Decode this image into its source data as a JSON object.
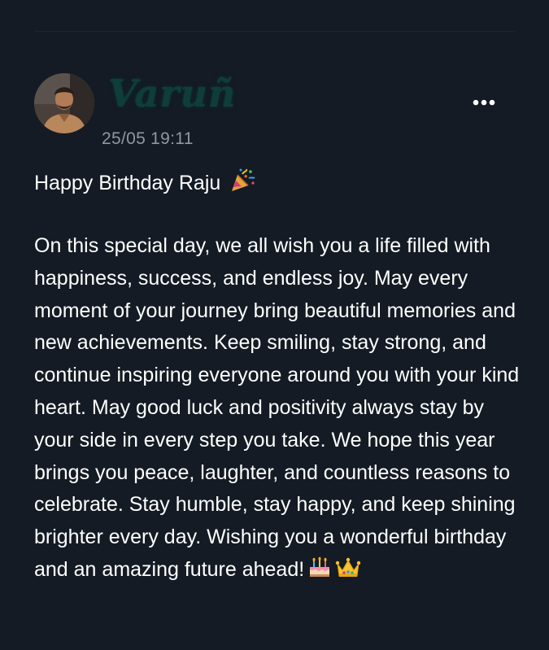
{
  "post": {
    "author_name": "Varuñ",
    "timestamp": "25/05 19:11",
    "title": "Happy Birthday Raju",
    "title_emoji": "party-popper-icon",
    "body": "On this special day, we all wish you a life filled with happiness, success, and endless joy. May every moment of your journey bring beautiful memories and new achievements. Keep smiling, stay strong, and continue inspiring everyone around you with your kind heart. May good luck and positivity always stay by your side in every step you take. We hope this year brings you peace, laughter, and countless reasons to celebrate. Stay humble, stay happy, and keep shining brighter every day. Wishing you a wonderful birthday and an amazing future ahead!",
    "body_emojis": [
      "birthday-cake-icon",
      "crown-icon"
    ]
  },
  "colors": {
    "background": "#141b24",
    "text": "#ffffff",
    "muted": "#8e98a3",
    "author_name": "#0f3d3a"
  }
}
